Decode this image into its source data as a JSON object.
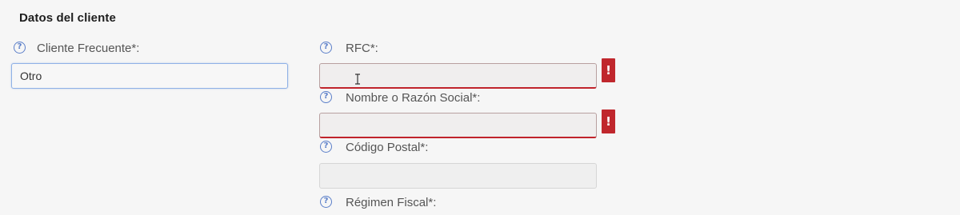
{
  "section": {
    "title": "Datos del cliente"
  },
  "fields": {
    "cliente_frecuente": {
      "label": "Cliente Frecuente*:",
      "value": "Otro",
      "help_icon": "question-icon"
    },
    "rfc": {
      "label": "RFC*:",
      "value": "",
      "error_badge": "!",
      "help_icon": "question-icon"
    },
    "nombre_razon_social": {
      "label": "Nombre o Razón Social*:",
      "value": "",
      "error_badge": "!",
      "help_icon": "question-icon"
    },
    "codigo_postal": {
      "label": "Código Postal*:",
      "value": "",
      "help_icon": "question-icon"
    },
    "regimen_fiscal": {
      "label": "Régimen Fiscal*:",
      "help_icon": "question-icon"
    }
  },
  "help_glyph": "?",
  "colors": {
    "help_icon": "#5b7fc9",
    "error": "#c0272d",
    "focus_border": "#8fb1e6",
    "background": "#f6f6f6"
  }
}
